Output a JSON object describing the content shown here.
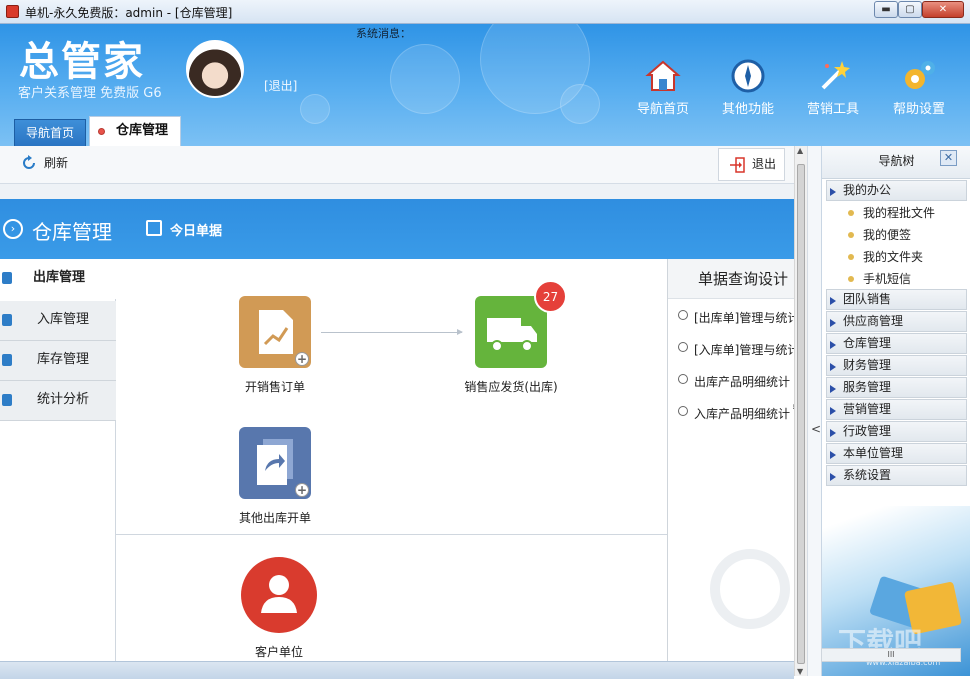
{
  "window": {
    "title": "单机-永久免费版：admin - [仓库管理]",
    "min_label": "▬",
    "max_label": "▢",
    "close_label": "✕"
  },
  "header": {
    "logo": "总管家",
    "tagline": "客户关系管理 免费版 G6",
    "logout": "[退出]",
    "system_message": "系统消息：",
    "tools": [
      {
        "label": "导航首页",
        "icon": "home-icon"
      },
      {
        "label": "其他功能",
        "icon": "compass-icon"
      },
      {
        "label": "营销工具",
        "icon": "magic-wand-icon"
      },
      {
        "label": "帮助设置",
        "icon": "gears-icon"
      }
    ]
  },
  "tabs": {
    "home": "导航首页",
    "warehouse": "仓库管理"
  },
  "toolbar": {
    "refresh": "刷新",
    "exit": "退出"
  },
  "section": {
    "title": "仓库管理",
    "today_docs": "今日单据"
  },
  "left_nav": [
    {
      "label": "出库管理",
      "active": true
    },
    {
      "label": "入库管理",
      "active": false
    },
    {
      "label": "库存管理",
      "active": false
    },
    {
      "label": "统计分析",
      "active": false
    }
  ],
  "tiles": {
    "order": "开销售订单",
    "ship": "销售应发货(出库)",
    "ship_badge": "27",
    "other": "其他出库开单",
    "client": "客户单位"
  },
  "query": {
    "title": "单据查询设计",
    "items": [
      "[出库单]管理与统计",
      "[入库单]管理与统计",
      "出库产品明细统计",
      "入库产品明细统计"
    ],
    "grip": "≡"
  },
  "scroll": {
    "up": "▲",
    "down": "▼",
    "collapse": "<",
    "h": "III"
  },
  "navtree": {
    "title": "导航树",
    "close": "✕",
    "office": {
      "label": "我的办公",
      "children": [
        "我的程批文件",
        "我的便签",
        "我的文件夹",
        "手机短信"
      ]
    },
    "groups": [
      "团队销售",
      "供应商管理",
      "仓库管理",
      "财务管理",
      "服务管理",
      "营销管理",
      "行政管理",
      "本单位管理",
      "系统设置"
    ],
    "watermark": "下载吧",
    "watermark_url": "www.xiazaiba.com"
  },
  "colors": {
    "header_blue": "#2f94e6",
    "section_blue": "#2f8ee0",
    "badge_red": "#e5403a"
  }
}
